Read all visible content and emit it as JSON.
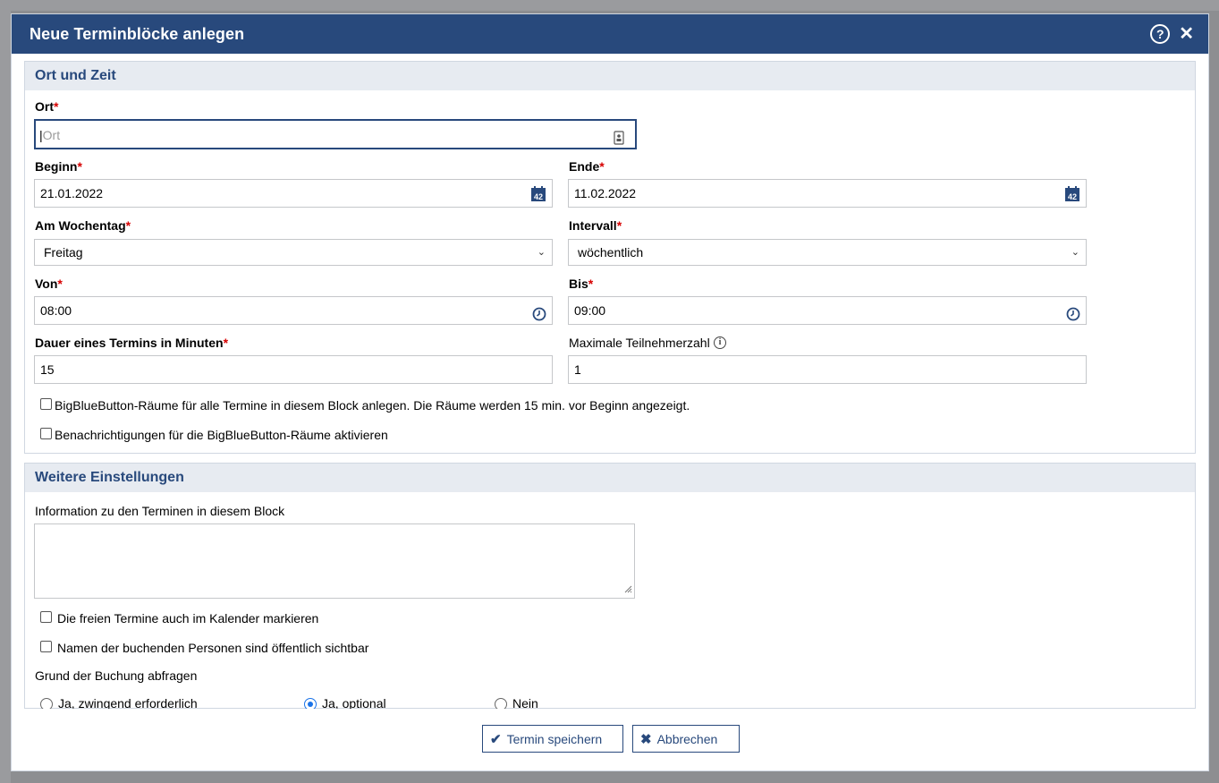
{
  "dialog": {
    "title": "Neue Terminblöcke anlegen"
  },
  "section1": {
    "legend": "Ort und Zeit",
    "ort": {
      "label": "Ort",
      "placeholder": "Ort",
      "value": ""
    },
    "beginn": {
      "label": "Beginn",
      "value": "21.01.2022",
      "icon_text": "42"
    },
    "ende": {
      "label": "Ende",
      "value": "11.02.2022",
      "icon_text": "42"
    },
    "wochentag": {
      "label": "Am Wochentag",
      "value": "Freitag"
    },
    "intervall": {
      "label": "Intervall",
      "value": "wöchentlich"
    },
    "von": {
      "label": "Von",
      "value": "08:00"
    },
    "bis": {
      "label": "Bis",
      "value": "09:00"
    },
    "dauer": {
      "label": "Dauer eines Termins in Minuten",
      "value": "15"
    },
    "teilnehmer": {
      "label": "Maximale Teilnehmerzahl",
      "value": "1"
    },
    "bbb_rooms": {
      "label": "BigBlueButton-Räume für alle Termine in diesem Block anlegen. Die Räume werden 15 min. vor Beginn angezeigt.",
      "checked": false
    },
    "bbb_notify": {
      "label": "Benachrichtigungen für die BigBlueButton-Räume aktivieren",
      "checked": false
    },
    "required_mark": "*"
  },
  "section2": {
    "legend": "Weitere Einstellungen",
    "info": {
      "label": "Information zu den Terminen in diesem Block",
      "value": ""
    },
    "calendar": {
      "label": "Die freien Termine auch im Kalender markieren",
      "checked": false
    },
    "names_public": {
      "label": "Namen der buchenden Personen sind öffentlich sichtbar",
      "checked": false
    },
    "reason": {
      "label": "Grund der Buchung abfragen",
      "options": [
        {
          "label": "Ja, zwingend erforderlich",
          "checked": false
        },
        {
          "label": "Ja, optional",
          "checked": true
        },
        {
          "label": "Nein",
          "checked": false
        }
      ]
    }
  },
  "footer": {
    "save_label": "Termin speichern",
    "cancel_label": "Abbrechen"
  },
  "colors": {
    "header_bg": "#28497c",
    "legend_bg": "#e7ebf1",
    "required": "#d60000",
    "radio_accent": "#1a73e8"
  },
  "icons": {
    "help": "help-circle-icon",
    "close": "close-icon",
    "calendar": "calendar-icon",
    "clock": "clock-icon",
    "info": "info-icon",
    "contact": "address-book-icon",
    "check": "check-icon",
    "cancel": "x-icon"
  }
}
